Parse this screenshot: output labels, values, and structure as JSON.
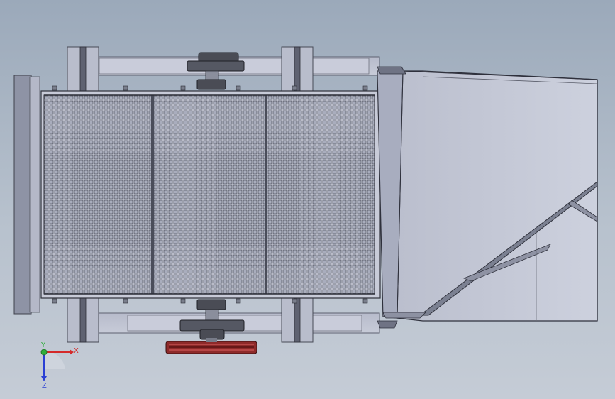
{
  "viewport": {
    "background_top": "#9ba9ba",
    "background_bottom": "#c5ccd6"
  },
  "model": {
    "frame_color": "#c3c7d6",
    "frame_dark": "#6b6e7c",
    "screen_color": "#babdcc",
    "screen_lines": "#3a3c48",
    "hopper_color": "#c0c4d3",
    "hopper_edge": "#2f313c",
    "gear_color": "#4a4c55",
    "pulley_color": "#8e2a2a"
  },
  "triad": {
    "x_label": "X",
    "y_label": "Y",
    "z_label": "Z",
    "x_color": "#d42a2a",
    "y_color": "#2fae3a",
    "z_color": "#2a3fd4"
  }
}
